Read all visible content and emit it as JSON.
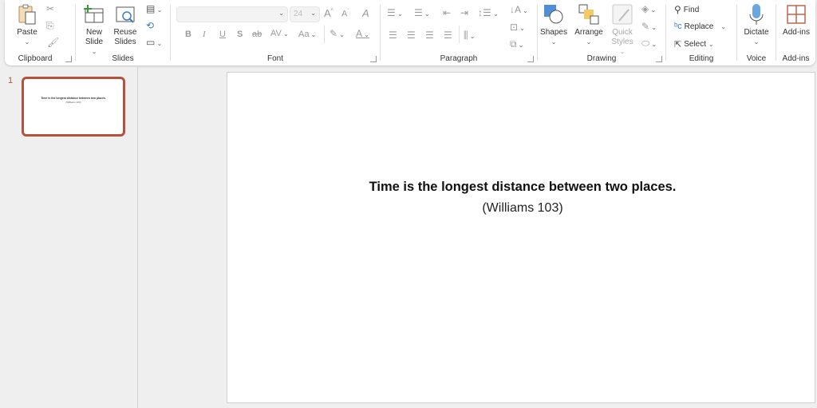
{
  "ribbon": {
    "clipboard": {
      "label": "Clipboard",
      "paste": "Paste",
      "cut_icon": "scissors-icon",
      "copy_icon": "copy-icon",
      "format_painter_icon": "format-painter-icon"
    },
    "slides": {
      "label": "Slides",
      "new_slide_line1": "New",
      "new_slide_line2": "Slide",
      "reuse_line1": "Reuse",
      "reuse_line2": "Slides"
    },
    "font": {
      "label": "Font",
      "font_name": "",
      "font_size": "24",
      "bold": "B",
      "italic": "I",
      "underline": "U",
      "shadow": "S",
      "strike": "ab",
      "spacing": "AV",
      "case": "Aa",
      "grow": "A",
      "shrink": "A",
      "font_color": "A"
    },
    "paragraph": {
      "label": "Paragraph"
    },
    "drawing": {
      "label": "Drawing",
      "shapes": "Shapes",
      "arrange": "Arrange",
      "quick_line1": "Quick",
      "quick_line2": "Styles"
    },
    "editing": {
      "label": "Editing",
      "find": "Find",
      "replace": "Replace",
      "select": "Select"
    },
    "voice": {
      "label": "Voice",
      "dictate": "Dictate"
    },
    "addins": {
      "label": "Add-ins",
      "addins": "Add-ins"
    }
  },
  "sidebar": {
    "slides": [
      {
        "number": "1",
        "title": "Time is the longest distance between two places.",
        "subtitle": "(Williams 103)"
      }
    ]
  },
  "slide": {
    "quote": "Time is the longest distance between two places.",
    "citation": "(Williams 103)"
  },
  "colors": {
    "accent": "#b5513c"
  }
}
